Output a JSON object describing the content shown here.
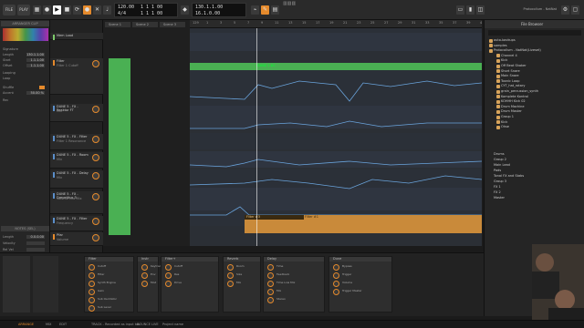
{
  "transport": {
    "file": "FILE",
    "play": "PLAY",
    "tempo": "120.00",
    "sig": "4/4",
    "pos_top": "1 1 1 00",
    "pos_top_right": "4.000",
    "pos_bottom": "1 1 1 00",
    "pos_bottom_right": "6.000",
    "loop_top": "130.1.1.00",
    "loop_bottom": "16.1.0.00"
  },
  "project_title": "Protocollum - NatNat",
  "left": {
    "inspector_title": "ARRANGER CLIP",
    "name_label": "Name",
    "signature_label": "Signature",
    "length_label": "Length",
    "length_value": "130.1.1.00",
    "start_label": "Start",
    "start_value": "1.1.1.00",
    "offset_label": "Offset",
    "offset_value": "1.1.1.00",
    "looping_label": "Looping",
    "loop_label": "Loop",
    "shuffle_label": "Shuffle",
    "accent_label": "Accent",
    "accent_value": "50.00 %",
    "rec_label": "Rec",
    "note_section": "NOTES (SEL)",
    "note_length_label": "Length",
    "note_length_value": "0.0.0.00",
    "note_velocity_label": "Velocity",
    "note_release_label": "Rel Vel",
    "expressions_label": "EXPRESSIONS",
    "pan_label": "Pan",
    "timbre_label": "Timbre",
    "pressure_label": "Pressure"
  },
  "tracks": [
    {
      "name": "Mem Load",
      "sub": "",
      "color": "#7cc96a"
    },
    {
      "name": "Filter",
      "sub": "Filter 1 Cutoff",
      "color": "#e58a2c"
    },
    {
      "name": "DUNE 5 - FX - Reaktor FT",
      "sub": "Mix",
      "color": "#5a8ec9"
    },
    {
      "name": "DUNE 5 - FX - Filter",
      "sub": "Filter 1 Resonance",
      "color": "#5a8ec9"
    },
    {
      "name": "DUNE 5 - FX - Room",
      "sub": "Mix",
      "color": "#5a8ec9"
    },
    {
      "name": "DUNE 5 - FX - Delay",
      "sub": "Mix",
      "color": "#5a8ec9"
    },
    {
      "name": "DUNE 5 - FX - Drepetitus 3",
      "sub": "Volume Mid Mix",
      "color": "#5a8ec9"
    },
    {
      "name": "DUNE 5 - FX - Filter",
      "sub": "Frequency",
      "color": "#5a8ec9"
    },
    {
      "name": "Pfar",
      "sub": "Volume",
      "color": "#e58a2c"
    }
  ],
  "scenes": [
    "Scene 1",
    "Scene 2",
    "Scene 3"
  ],
  "ruler": [
    "129",
    "1",
    "3",
    "5",
    "7",
    "9",
    "11",
    "13",
    "15",
    "17",
    "19",
    "21",
    "23",
    "25",
    "27",
    "29",
    "31",
    "33",
    "35",
    "37",
    "39",
    "41"
  ],
  "clips": {
    "green_label": "DUNE 1 #1",
    "orange_label": "Filter #3",
    "orange_label2": "Filter #1"
  },
  "browser": {
    "title": "File Browser",
    "items": [
      "auto-backups",
      "samples",
      "Protocollum - NatNat(Liveset)",
      "Channel 4",
      "Kick",
      "Off Beat Shaker",
      "Short Snare",
      "Main Snare",
      "Toonic Loop",
      "CYT_hat_rotary",
      "grain_percussion_synth",
      "Komplete Kontrol",
      "KOHHH Kick 02",
      "Drum Machine",
      "Drum Master",
      "Group 1",
      "Kick",
      "Ohse"
    ],
    "lower": [
      "Drums",
      "Group 2",
      "Main Lead",
      "Pads",
      "Tonal FX and Stabs",
      "Group 3",
      "FX 1",
      "FX 2",
      "Master"
    ]
  },
  "devices": [
    {
      "title": "Filter",
      "labels": [
        "Cutoff",
        "Filter",
        "Synth Engine",
        "Gain",
        "Sub Oscillator",
        "Sub Level"
      ]
    },
    {
      "title": "Instr",
      "labels": [
        "Keytrack",
        "Env",
        "Mod"
      ]
    },
    {
      "title": "Filter+",
      "labels": [
        "Cutoff",
        "Res",
        "Drive"
      ]
    },
    {
      "title": "Reverb",
      "labels": [
        "Room",
        "Size",
        "Mix"
      ]
    },
    {
      "title": "Delay",
      "labels": [
        "Time",
        "Feedback",
        "Time Low Mix",
        "Mix",
        "Stereo"
      ]
    },
    {
      "title": "Dune",
      "labels": [
        "Bypass",
        "Trigger",
        "Volume",
        "Trigger Master"
      ]
    }
  ],
  "status": {
    "arranger": "ARRANGE",
    "mix": "MIX",
    "edit": "EDIT",
    "info": "TRACK - Recorded as input too",
    "sel": "BOUNCE LIVE",
    "right": "Project name"
  },
  "colors": {
    "accent": "#e58a2c",
    "green_clip": "#4ab053",
    "automation_blue": "#6aa4dc",
    "orange_clip": "#c98a3a"
  }
}
